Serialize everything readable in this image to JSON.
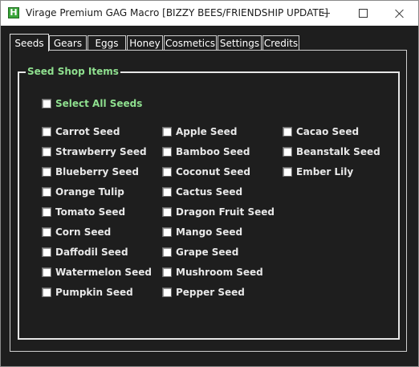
{
  "window": {
    "title": "Virage Premium GAG Macro [BIZZY BEES/FRIENDSHIP UPDATE]",
    "app_icon_letter": "H"
  },
  "tabs": [
    {
      "label": "Seeds",
      "active": true
    },
    {
      "label": "Gears",
      "active": false
    },
    {
      "label": "Eggs",
      "active": false
    },
    {
      "label": "Honey",
      "active": false
    },
    {
      "label": "Cosmetics",
      "active": false
    },
    {
      "label": "Settings",
      "active": false
    },
    {
      "label": "Credits",
      "active": false
    }
  ],
  "group": {
    "title": "Seed Shop Items",
    "select_all": {
      "label": "Select All Seeds",
      "checked": false
    }
  },
  "seeds": {
    "column1": [
      {
        "label": "Carrot Seed",
        "checked": false
      },
      {
        "label": "Strawberry Seed",
        "checked": false
      },
      {
        "label": "Blueberry Seed",
        "checked": false
      },
      {
        "label": "Orange Tulip",
        "checked": false
      },
      {
        "label": "Tomato Seed",
        "checked": false
      },
      {
        "label": "Corn Seed",
        "checked": false
      },
      {
        "label": "Daffodil Seed",
        "checked": false
      },
      {
        "label": "Watermelon Seed",
        "checked": false
      },
      {
        "label": "Pumpkin Seed",
        "checked": false
      }
    ],
    "column2": [
      {
        "label": "Apple Seed",
        "checked": false
      },
      {
        "label": "Bamboo Seed",
        "checked": false
      },
      {
        "label": "Coconut Seed",
        "checked": false
      },
      {
        "label": "Cactus Seed",
        "checked": false
      },
      {
        "label": "Dragon Fruit Seed",
        "checked": false
      },
      {
        "label": "Mango Seed",
        "checked": false
      },
      {
        "label": "Grape Seed",
        "checked": false
      },
      {
        "label": "Mushroom Seed",
        "checked": false
      },
      {
        "label": "Pepper Seed",
        "checked": false
      }
    ],
    "column3": [
      {
        "label": "Cacao Seed",
        "checked": false
      },
      {
        "label": "Beanstalk Seed",
        "checked": false
      },
      {
        "label": "Ember Lily",
        "checked": false
      }
    ]
  },
  "colors": {
    "background": "#1e1e1e",
    "accent_green": "#8fe08f",
    "text": "#e8e8e8"
  }
}
